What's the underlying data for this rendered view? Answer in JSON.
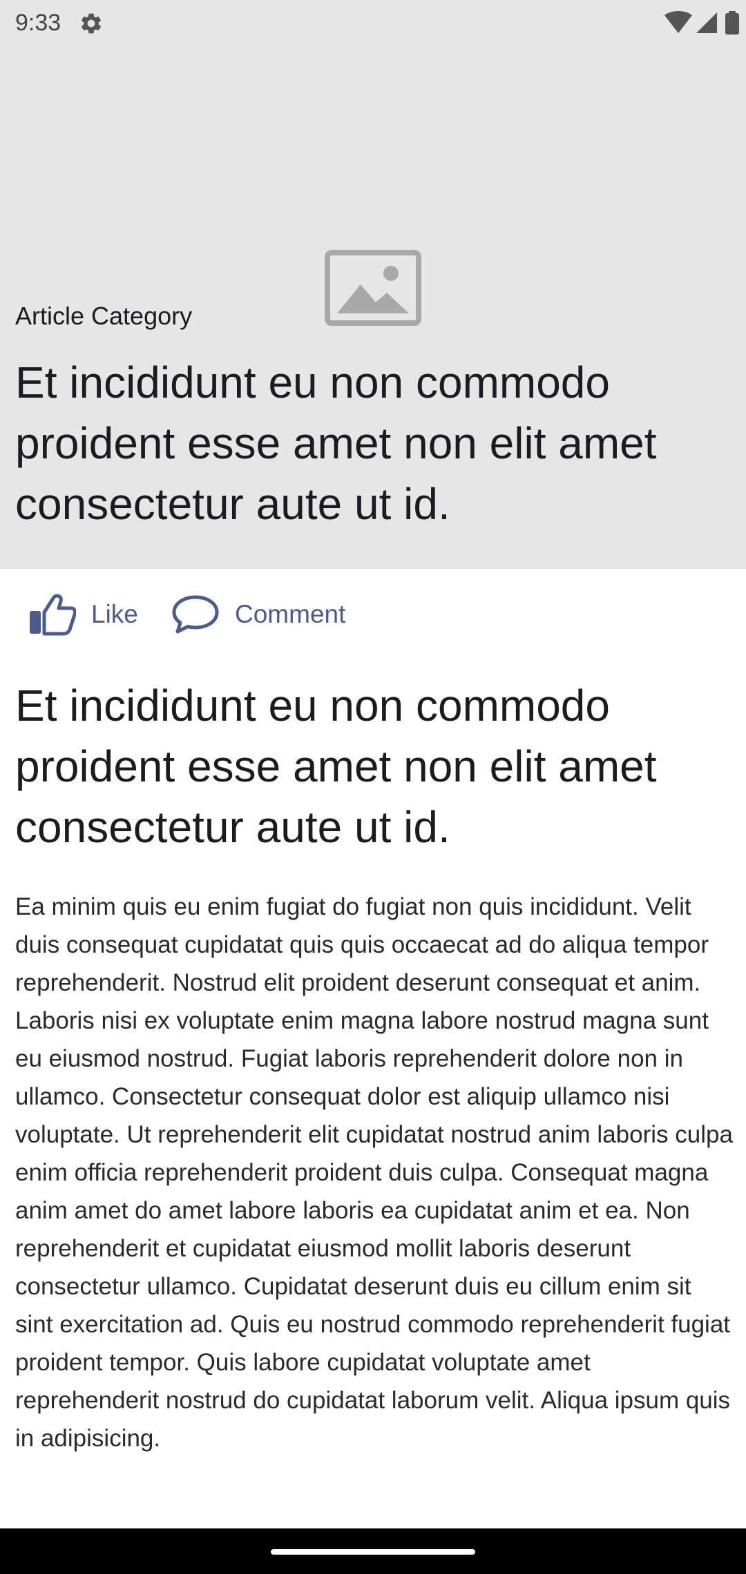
{
  "status_bar": {
    "time": "9:33",
    "icons": [
      "settings-icon",
      "wifi-icon",
      "cellular-signal-icon",
      "battery-icon"
    ]
  },
  "hero": {
    "image_icon": "image-placeholder-icon",
    "category": "Article Category",
    "title": "Et incididunt eu non commodo proident esse amet non elit amet consectetur aute ut id."
  },
  "actions": {
    "like_label": "Like",
    "like_icon": "thumbs-up-icon",
    "comment_label": "Comment",
    "comment_icon": "comment-bubble-icon",
    "accent_color": "#4a5b8f"
  },
  "article": {
    "title": "Et incididunt eu non commodo proident esse amet non elit amet consectetur aute ut id.",
    "body": "Ea minim quis eu enim fugiat do fugiat non quis incididunt. Velit duis consequat cupidatat quis quis occaecat ad do aliqua tempor reprehenderit. Nostrud elit proident deserunt consequat et anim. Laboris nisi ex voluptate enim magna labore nostrud magna sunt eu eiusmod nostrud. Fugiat laboris reprehenderit dolore non in ullamco. Consectetur consequat dolor est aliquip ullamco nisi voluptate. Ut reprehenderit elit cupidatat nostrud anim laboris culpa enim officia reprehenderit proident duis culpa. Consequat magna anim amet do amet labore laboris ea cupidatat anim et ea. Non reprehenderit et cupidatat eiusmod mollit laboris deserunt consectetur ullamco. Cupidatat deserunt duis eu cillum enim sit sint exercitation ad. Quis eu nostrud commodo reprehenderit fugiat proident tempor. Quis labore cupidatat voluptate amet reprehenderit nostrud do cupidatat laborum velit. Aliqua ipsum quis in adipisicing."
  },
  "colors": {
    "hero_background": "#e6e6e6",
    "text": "#1c1b1f",
    "nav_bar": "#000000"
  }
}
